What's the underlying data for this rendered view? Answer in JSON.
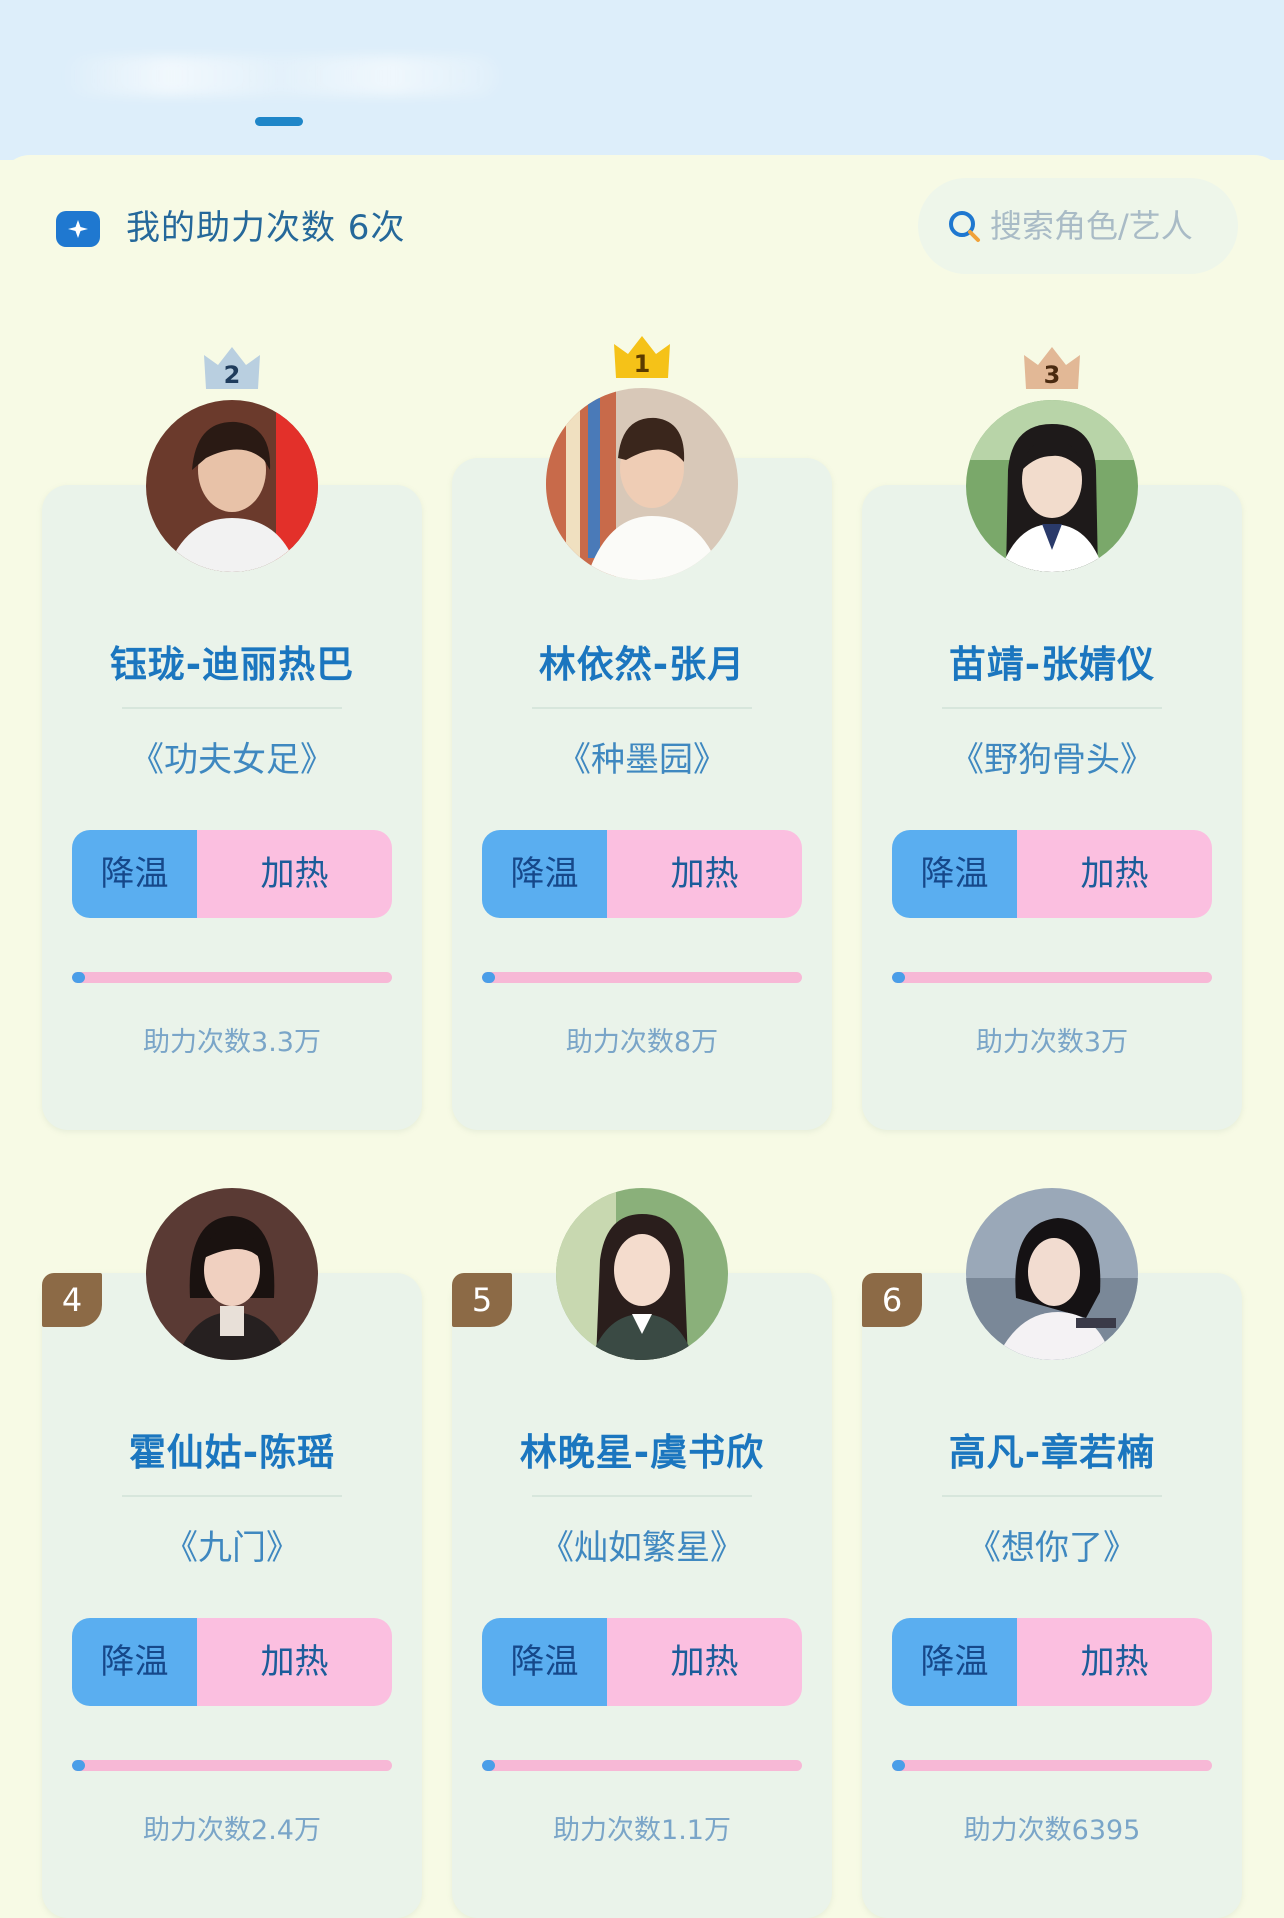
{
  "header": {
    "assist_label": "我的助力次数 6次",
    "search_placeholder": "搜索角色/艺人"
  },
  "buttons": {
    "cool_label": "降温",
    "heat_label": "加热"
  },
  "colors": {
    "accent_blue": "#1f78d0",
    "cool_button": "#5aaef0",
    "heat_button": "#fbbfe0",
    "card_bg": "#eaf3ea",
    "rank_tag": "#8c6a46"
  },
  "cards": [
    {
      "rank": "2",
      "name": "钰珑-迪丽热巴",
      "work": "《功夫女足》",
      "count": "助力次数3.3万",
      "progress": 0.04
    },
    {
      "rank": "1",
      "name": "林依然-张月",
      "work": "《种墨园》",
      "count": "助力次数8万",
      "progress": 0.04
    },
    {
      "rank": "3",
      "name": "苗靖-张婧仪",
      "work": "《野狗骨头》",
      "count": "助力次数3万",
      "progress": 0.04
    },
    {
      "rank": "4",
      "name": "霍仙姑-陈瑶",
      "work": "《九门》",
      "count": "助力次数2.4万",
      "progress": 0.04
    },
    {
      "rank": "5",
      "name": "林晚星-虞书欣",
      "work": "《灿如繁星》",
      "count": "助力次数1.1万",
      "progress": 0.04
    },
    {
      "rank": "6",
      "name": "高凡-章若楠",
      "work": "《想你了》",
      "count": "助力次数6395",
      "progress": 0.04
    }
  ]
}
